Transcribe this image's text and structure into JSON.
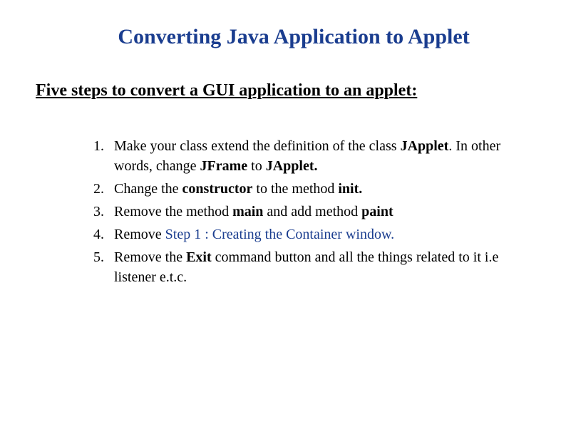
{
  "title": "Converting Java Application to Applet",
  "subtitle": "Five steps to convert a GUI application to an applet:",
  "steps": [
    {
      "num": "1.",
      "parts": [
        {
          "text": "Make your class extend the definition of the class "
        },
        {
          "text": "JApplet",
          "bold": true
        },
        {
          "text": ". In other words, change "
        },
        {
          "text": "JFrame",
          "bold": true
        },
        {
          "text": " to "
        },
        {
          "text": "JApplet.",
          "bold": true
        }
      ]
    },
    {
      "num": "2.",
      "parts": [
        {
          "text": "Change the "
        },
        {
          "text": "constructor",
          "bold": true
        },
        {
          "text": " to the method  "
        },
        {
          "text": "init.",
          "bold": true
        }
      ]
    },
    {
      "num": "3.",
      "parts": [
        {
          "text": "Remove the method "
        },
        {
          "text": "main ",
          "bold": true
        },
        {
          "text": " and add method "
        },
        {
          "text": "paint",
          "bold": true
        }
      ]
    },
    {
      "num": "4.",
      "parts": [
        {
          "text": "Remove  "
        },
        {
          "text": "Step 1 : Creating the Container window.",
          "blue": true
        }
      ]
    },
    {
      "num": "5.",
      "parts": [
        {
          "text": "Remove the "
        },
        {
          "text": "Exit ",
          "bold": true
        },
        {
          "text": "command button and all the things related to it  i.e listener e.t.c."
        }
      ]
    }
  ]
}
